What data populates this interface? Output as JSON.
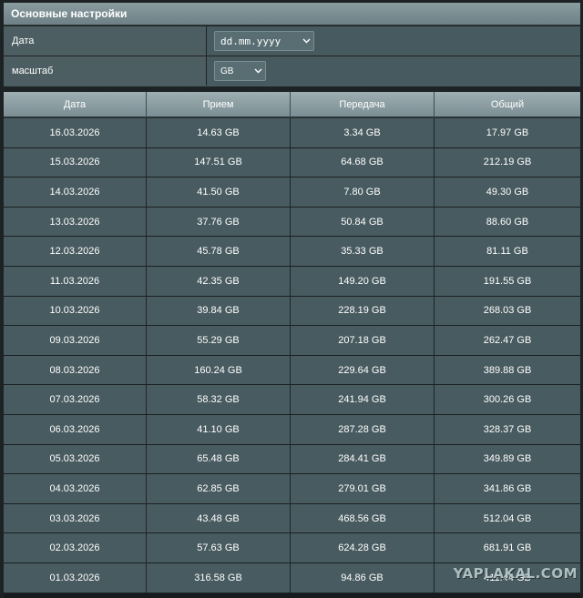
{
  "settings": {
    "title": "Основные настройки",
    "date_label": "Дата",
    "date_value": "dd.mm.yyyy",
    "scale_label": "масштаб",
    "scale_value": "GB"
  },
  "table": {
    "headers": [
      "Дата",
      "Прием",
      "Передача",
      "Общий"
    ],
    "rows": [
      [
        "16.03.2026",
        "14.63 GB",
        "3.34 GB",
        "17.97 GB"
      ],
      [
        "15.03.2026",
        "147.51 GB",
        "64.68 GB",
        "212.19 GB"
      ],
      [
        "14.03.2026",
        "41.50 GB",
        "7.80 GB",
        "49.30 GB"
      ],
      [
        "13.03.2026",
        "37.76 GB",
        "50.84 GB",
        "88.60 GB"
      ],
      [
        "12.03.2026",
        "45.78 GB",
        "35.33 GB",
        "81.11 GB"
      ],
      [
        "11.03.2026",
        "42.35 GB",
        "149.20 GB",
        "191.55 GB"
      ],
      [
        "10.03.2026",
        "39.84 GB",
        "228.19 GB",
        "268.03 GB"
      ],
      [
        "09.03.2026",
        "55.29 GB",
        "207.18 GB",
        "262.47 GB"
      ],
      [
        "08.03.2026",
        "160.24 GB",
        "229.64 GB",
        "389.88 GB"
      ],
      [
        "07.03.2026",
        "58.32 GB",
        "241.94 GB",
        "300.26 GB"
      ],
      [
        "06.03.2026",
        "41.10 GB",
        "287.28 GB",
        "328.37 GB"
      ],
      [
        "05.03.2026",
        "65.48 GB",
        "284.41 GB",
        "349.89 GB"
      ],
      [
        "04.03.2026",
        "62.85 GB",
        "279.01 GB",
        "341.86 GB"
      ],
      [
        "03.03.2026",
        "43.48 GB",
        "468.56 GB",
        "512.04 GB"
      ],
      [
        "02.03.2026",
        "57.63 GB",
        "624.28 GB",
        "681.91 GB"
      ],
      [
        "01.03.2026",
        "316.58 GB",
        "94.86 GB",
        "411.44 GB"
      ]
    ]
  },
  "watermark": "YAPLAKAL.COM",
  "icons": {
    "dropdown": "chevron-down-icon"
  }
}
